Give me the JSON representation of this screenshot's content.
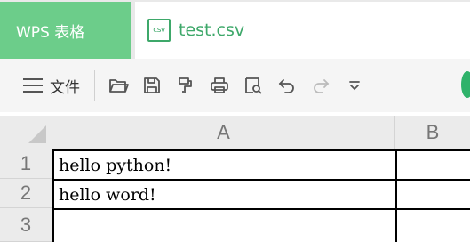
{
  "tabs": {
    "app_label": "WPS 表格",
    "doc_icon_text": "csv",
    "doc_name": "test.csv"
  },
  "toolbar": {
    "menu_label": "文件",
    "icons": [
      "open-icon",
      "save-icon",
      "format-painter-icon",
      "print-icon",
      "print-preview-icon",
      "undo-icon",
      "redo-icon",
      "more-icon"
    ]
  },
  "sheet": {
    "columns": [
      "A",
      "B"
    ],
    "rows": [
      {
        "number": "1",
        "cells": [
          "hello python!",
          ""
        ]
      },
      {
        "number": "2",
        "cells": [
          "hello word!",
          ""
        ]
      },
      {
        "number": "3",
        "cells": [
          "",
          ""
        ]
      }
    ]
  },
  "colors": {
    "app_tab": "#6ccd8a",
    "accent": "#3ea86a",
    "header_bg": "#ebebeb"
  }
}
